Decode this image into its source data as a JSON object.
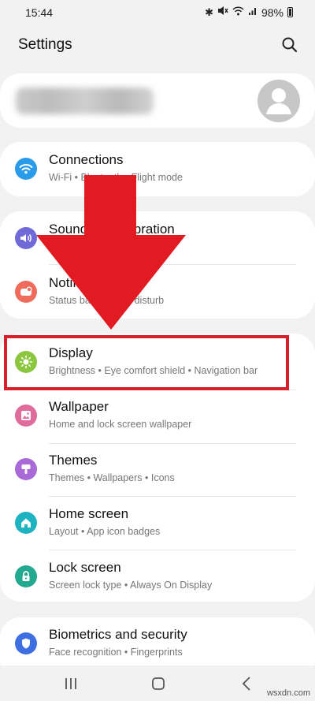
{
  "status_bar": {
    "time": "15:44",
    "battery": "98%",
    "icons": [
      "bluetooth-icon",
      "mute-icon",
      "wifi-icon",
      "signal-icon",
      "battery-icon"
    ]
  },
  "header": {
    "title": "Settings"
  },
  "watermark": "wsxdn.com",
  "colors": {
    "connections": "#2a9be8",
    "sounds": "#6f6ad8",
    "notifications": "#ef6b5c",
    "display": "#8cc63f",
    "wallpaper": "#e06b9d",
    "themes": "#a96ad8",
    "home_screen": "#1eb3c0",
    "lock_screen": "#22a98f",
    "biometrics": "#3d6fe0",
    "highlight": "#d8202a",
    "arrow": "#e21b23"
  },
  "groups": [
    {
      "items": [
        {
          "label": "Connections",
          "sub": "Wi-Fi  •  Bluetooth  •  Flight mode",
          "icon": "wifi-icon"
        }
      ]
    },
    {
      "items": [
        {
          "label": "Sounds and vibration",
          "sub": "Sound mode  •  Ringtone",
          "icon": "volume-icon"
        },
        {
          "label": "Notifications",
          "sub": "Status bar  •  Do not disturb",
          "icon": "notification-icon"
        }
      ]
    },
    {
      "items": [
        {
          "label": "Display",
          "sub": "Brightness  •  Eye comfort shield  •  Navigation bar",
          "icon": "sun-icon"
        },
        {
          "label": "Wallpaper",
          "sub": "Home and lock screen wallpaper",
          "icon": "image-icon"
        },
        {
          "label": "Themes",
          "sub": "Themes  •  Wallpapers  •  Icons",
          "icon": "brush-icon"
        },
        {
          "label": "Home screen",
          "sub": "Layout  •  App icon badges",
          "icon": "home-icon"
        },
        {
          "label": "Lock screen",
          "sub": "Screen lock type  •  Always On Display",
          "icon": "lock-icon"
        }
      ]
    },
    {
      "items": [
        {
          "label": "Biometrics and security",
          "sub": "Face recognition  •  Fingerprints",
          "icon": "shield-icon"
        }
      ]
    }
  ]
}
